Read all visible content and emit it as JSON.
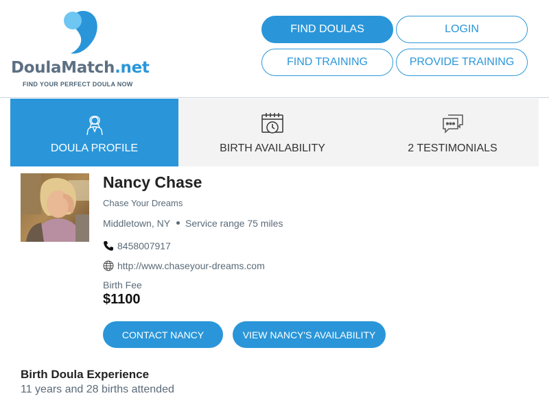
{
  "brand": {
    "name_part1": "Doula",
    "name_part2": "Match",
    "name_part3": ".net",
    "tagline": "FIND YOUR PERFECT DOULA NOW",
    "primary_color": "#2a96d9",
    "logo_gray": "#5d6f82"
  },
  "nav": {
    "find_doulas": "FIND DOULAS",
    "login": "LOGIN",
    "find_training": "FIND TRAINING",
    "provide_training": "PROVIDE TRAINING"
  },
  "tabs": [
    {
      "label": "DOULA PROFILE",
      "icon": "doula-person-icon",
      "active": true
    },
    {
      "label": "BIRTH AVAILABILITY",
      "icon": "calendar-clock-icon",
      "active": false
    },
    {
      "label": "2 TESTIMONIALS",
      "icon": "chat-bubbles-icon",
      "active": false
    }
  ],
  "profile": {
    "name": "Nancy Chase",
    "business": "Chase Your Dreams",
    "location": "Middletown, NY",
    "service_range": "Service range 75 miles",
    "phone": "8458007917",
    "website": "http://www.chaseyour-dreams.com",
    "fee_label": "Birth Fee",
    "fee_value": "$1100",
    "contact_button": "CONTACT NANCY",
    "availability_button": "VIEW NANCY'S AVAILABILITY"
  },
  "experience": {
    "title": "Birth Doula Experience",
    "body": "11 years and 28 births attended"
  }
}
